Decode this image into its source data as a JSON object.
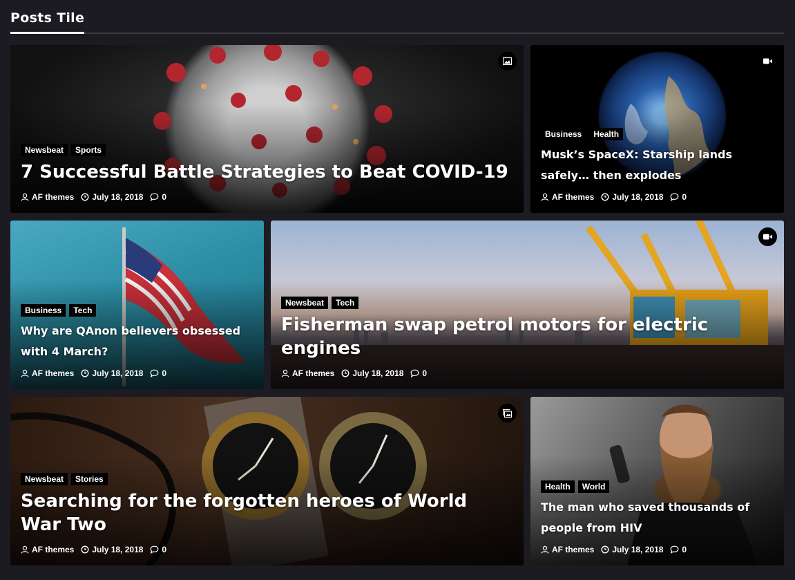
{
  "section": {
    "title": "Posts Tile"
  },
  "posts": [
    {
      "tags": [
        "Newsbeat",
        "Sports"
      ],
      "title": "7 Successful Battle Strategies to Beat COVID-19",
      "author": "AF themes",
      "date": "July 18, 2018",
      "comments": "0",
      "format_icon": "image-icon"
    },
    {
      "tags": [
        "Business",
        "Health"
      ],
      "title": "Musk’s SpaceX: Starship lands safely… then explodes",
      "author": "AF themes",
      "date": "July 18, 2018",
      "comments": "0",
      "format_icon": "video-icon"
    },
    {
      "tags": [
        "Business",
        "Tech"
      ],
      "title": "Why are QAnon believers obsessed with 4 March?",
      "author": "AF themes",
      "date": "July 18, 2018",
      "comments": "0",
      "format_icon": ""
    },
    {
      "tags": [
        "Newsbeat",
        "Tech"
      ],
      "title": "Fisherman swap petrol motors for electric engines",
      "author": "AF themes",
      "date": "July 18, 2018",
      "comments": "0",
      "format_icon": "video-icon"
    },
    {
      "tags": [
        "Newsbeat",
        "Stories"
      ],
      "title": "Searching for the forgotten heroes of World War Two",
      "author": "AF themes",
      "date": "July 18, 2018",
      "comments": "0",
      "format_icon": "gallery-icon"
    },
    {
      "tags": [
        "Health",
        "World"
      ],
      "title": "The man who saved thousands of people from HIV",
      "author": "AF themes",
      "date": "July 18, 2018",
      "comments": "0",
      "format_icon": ""
    }
  ]
}
